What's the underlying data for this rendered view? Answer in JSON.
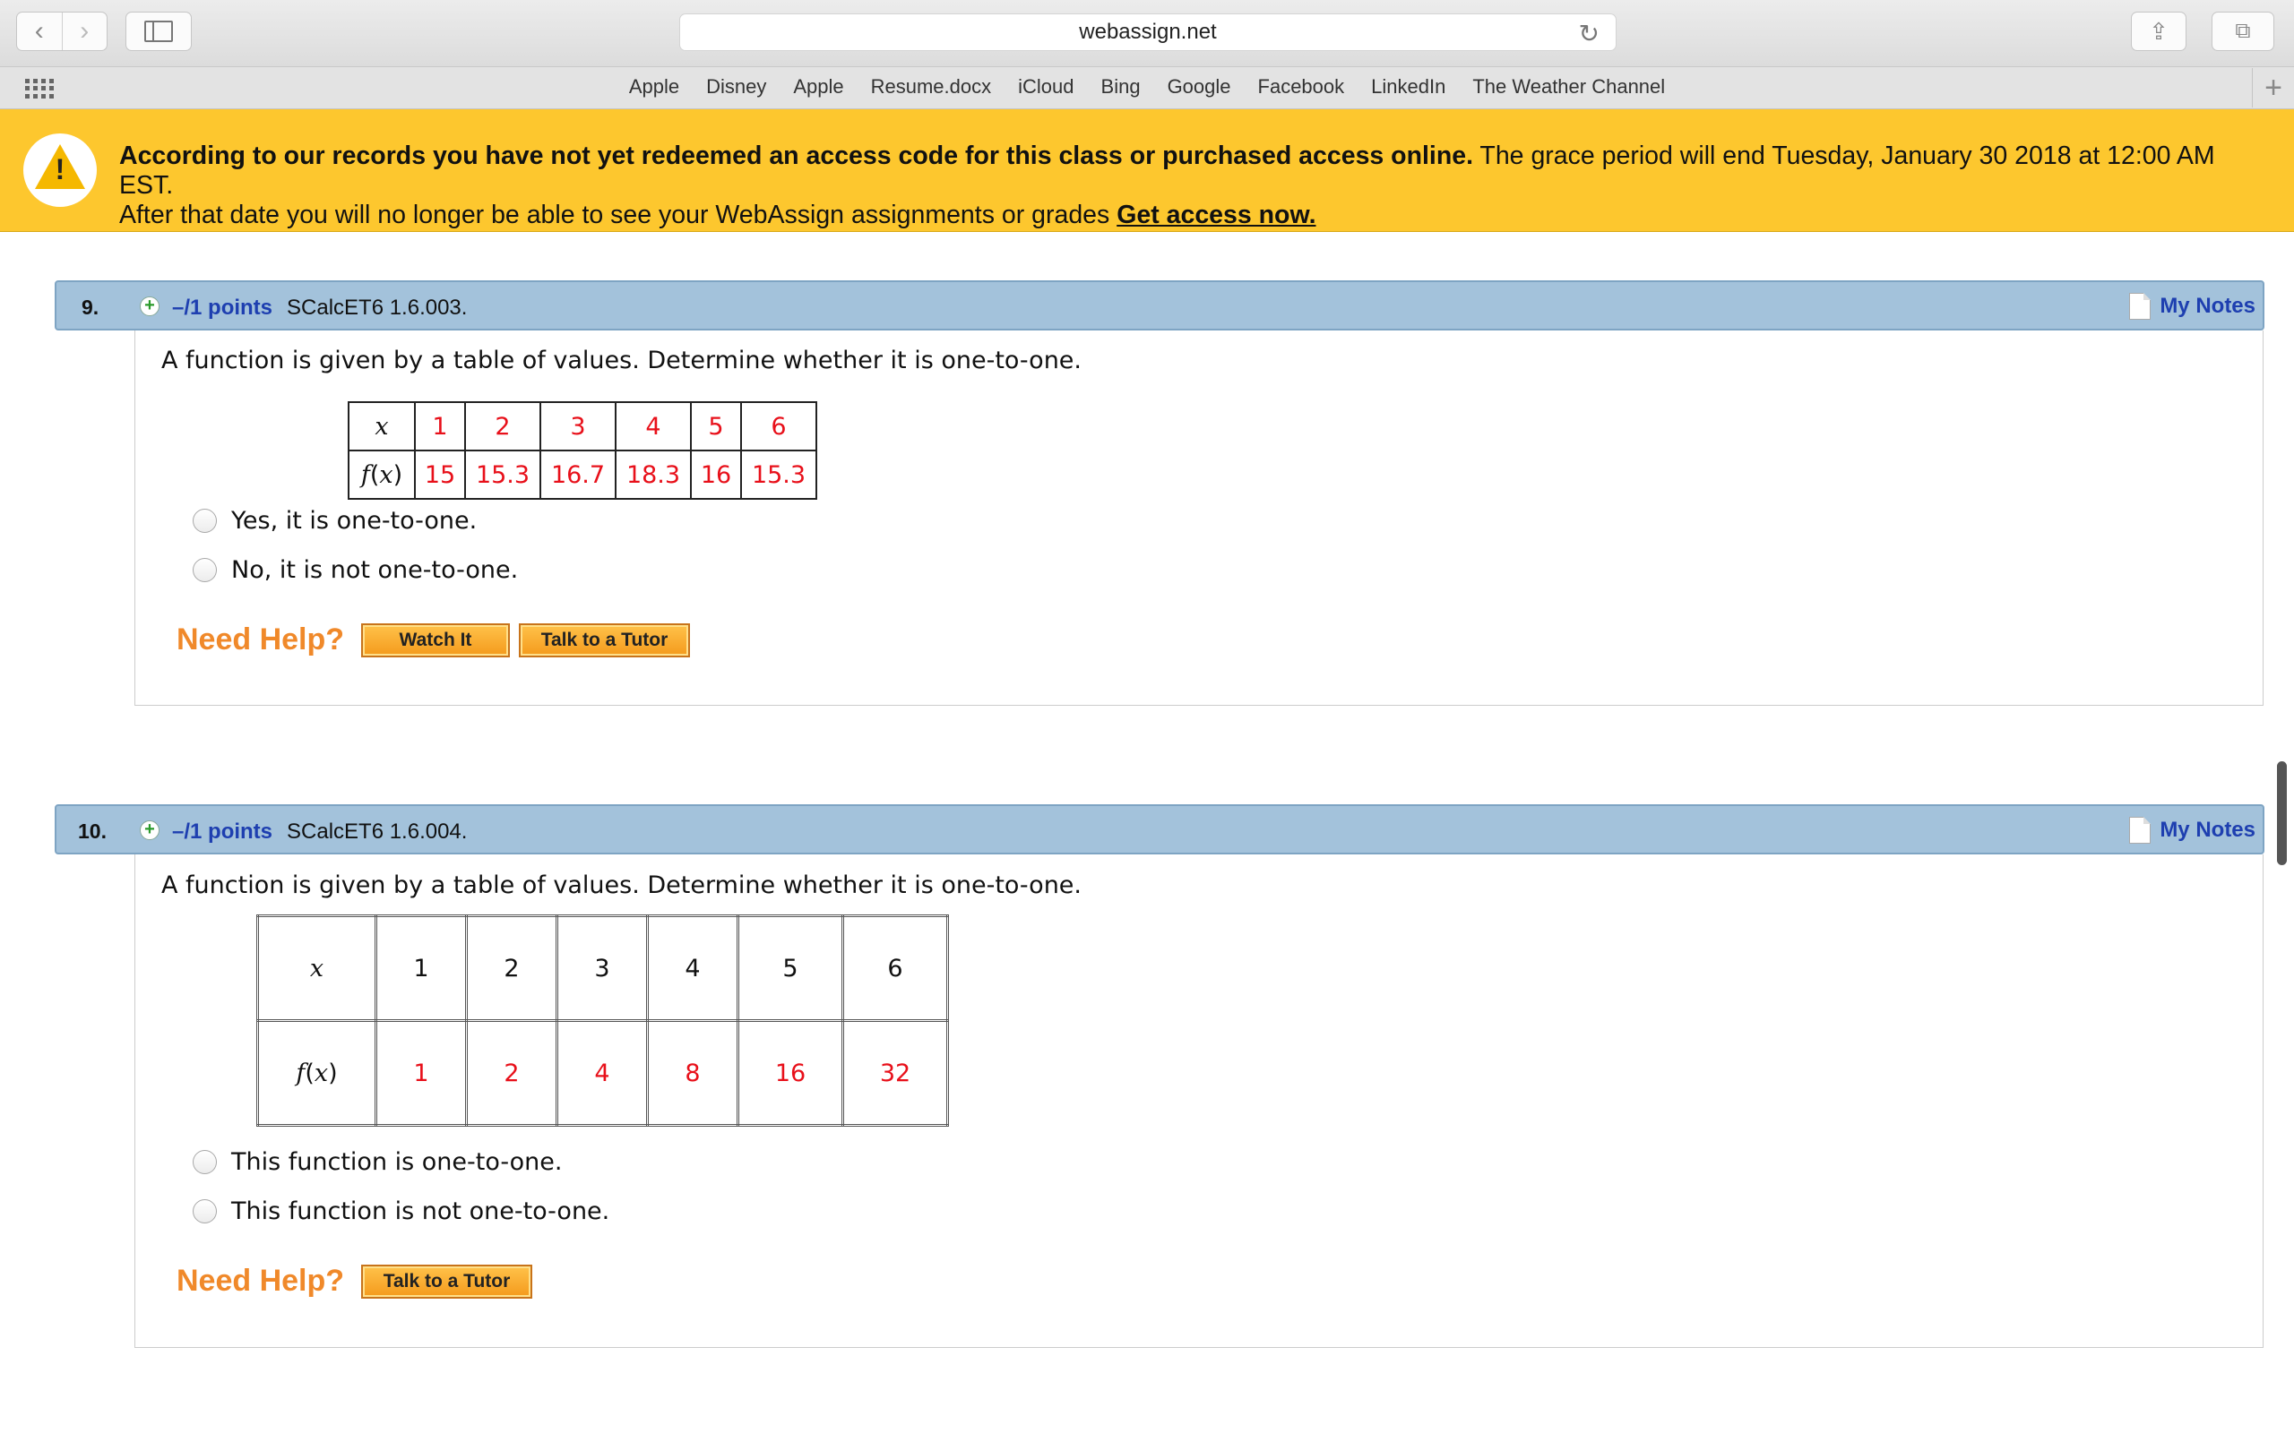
{
  "browser": {
    "url": "webassign.net",
    "bookmarks": [
      "Apple",
      "Disney",
      "Apple",
      "Resume.docx",
      "iCloud",
      "Bing",
      "Google",
      "Facebook",
      "LinkedIn",
      "The Weather Channel"
    ]
  },
  "banner": {
    "bold_text": "According to our records you have not yet redeemed an access code for this class or purchased access online.",
    "line1_rest": " The grace period will end Tuesday, January 30 2018 at 12:00 AM EST.",
    "line2": "After that date you will no longer be able to see your WebAssign assignments or grades ",
    "link": "Get access now."
  },
  "questions": [
    {
      "number": "9.",
      "points": "–/1 points",
      "code": "SCalcET6 1.6.003.",
      "notes_label": "My Notes",
      "prompt": "A function is given by a table of values. Determine whether it is one-to-one.",
      "table": {
        "x_label": "x",
        "fx_label": "f(x)",
        "x": [
          "1",
          "2",
          "3",
          "4",
          "5",
          "6"
        ],
        "fx": [
          "15",
          "15.3",
          "16.7",
          "18.3",
          "16",
          "15.3"
        ]
      },
      "choices": [
        "Yes, it is one-to-one.",
        "No, it is not one-to-one."
      ],
      "need_help": "Need Help?",
      "help_buttons": [
        "Watch It",
        "Talk to a Tutor"
      ]
    },
    {
      "number": "10.",
      "points": "–/1 points",
      "code": "SCalcET6 1.6.004.",
      "notes_label": "My Notes",
      "prompt": "A function is given by a table of values. Determine whether it is one-to-one.",
      "table": {
        "x_label": "x",
        "fx_label": "f(x)",
        "x": [
          "1",
          "2",
          "3",
          "4",
          "5",
          "6"
        ],
        "fx": [
          "1",
          "2",
          "4",
          "8",
          "16",
          "32"
        ]
      },
      "choices": [
        "This function is one-to-one.",
        "This function is not one-to-one."
      ],
      "need_help": "Need Help?",
      "help_buttons": [
        "Talk to a Tutor"
      ]
    }
  ],
  "colors": {
    "banner": "#fdc72e",
    "question_header": "#a3c2db",
    "link_blue": "#1e3fb0",
    "table_value_red": "#e8101a",
    "need_help_orange": "#f0892a"
  }
}
